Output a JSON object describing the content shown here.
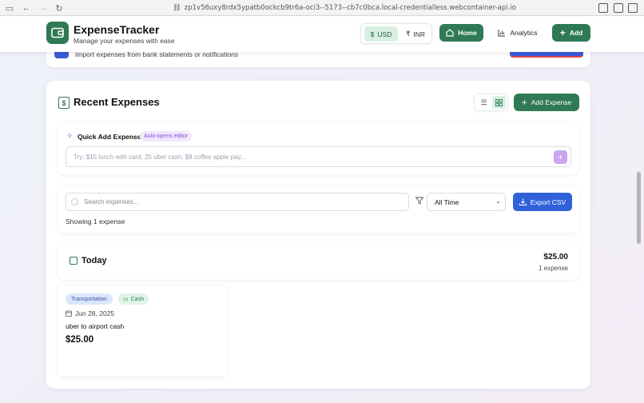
{
  "browser": {
    "url": "zp1v56uxy8rdx5ypatb0ockcb9tr6a-oci3--5173--cb7c0bca.local-credentialless.webcontainer-api.io"
  },
  "header": {
    "title": "ExpenseTracker",
    "subtitle": "Manage your expenses with ease",
    "currency_usd": "USD",
    "currency_usd_symbol": "$",
    "currency_inr": "INR",
    "currency_inr_symbol": "₹",
    "home_label": "Home",
    "analytics_label": "Analytics",
    "add_label": "Add"
  },
  "import_card": {
    "text": "Import expenses from bank statements or notifications"
  },
  "recent": {
    "title": "Recent Expenses",
    "add_expense_label": "Add Expense"
  },
  "quick_add": {
    "title": "Quick Add Expense",
    "badge": "Auto-opens editor",
    "placeholder": "Try: $15 lunch with card, 25 uber cash, $8 coffee apple pay...",
    "plus": "+"
  },
  "search": {
    "placeholder": "Search expenses...",
    "time_filter": "All Time",
    "export_label": "Export CSV",
    "showing_text": "Showing 1 expense"
  },
  "groups": [
    {
      "title": "Today",
      "total": "$25.00",
      "count": "1 expense",
      "expenses": [
        {
          "category": "Transportation",
          "payment": "Cash",
          "date": "Jun 28, 2025",
          "description": "uber to airport cash",
          "amount": "$25.00"
        }
      ]
    }
  ],
  "colors": {
    "primary_green": "#2f7a55",
    "primary_blue": "#3161d9",
    "accent_purple": "#8b5cf6"
  },
  "icons": {
    "logo": "wallet-icon",
    "home": "home-icon",
    "analytics": "bar-chart-icon",
    "add": "plus-icon",
    "recent": "dollar-receipt-icon",
    "sparkle": "sparkles-icon",
    "filter": "filter-icon",
    "export": "download-icon",
    "calendar": "calendar-icon"
  }
}
